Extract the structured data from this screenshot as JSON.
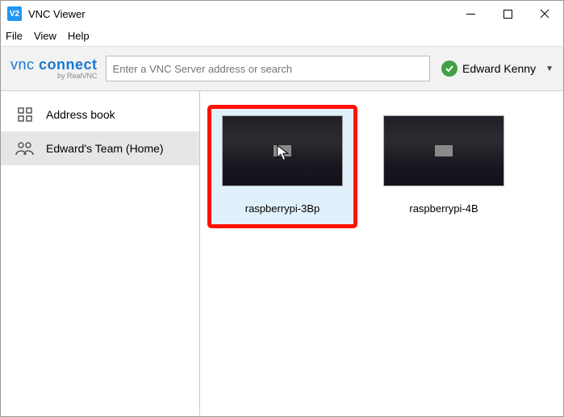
{
  "window": {
    "title": "VNC Viewer",
    "app_icon_text": "V2"
  },
  "menu": {
    "file": "File",
    "view": "View",
    "help": "Help"
  },
  "toolbar": {
    "logo_main_a": "vnc",
    "logo_main_b": "connect",
    "logo_sub": "by RealVNC",
    "search_placeholder": "Enter a VNC Server address or search",
    "user_name": "Edward Kenny"
  },
  "sidebar": {
    "items": [
      {
        "label": "Address book"
      },
      {
        "label": "Edward's Team (Home)"
      }
    ]
  },
  "connections": [
    {
      "label": "raspberrypi-3Bp",
      "selected": true
    },
    {
      "label": "raspberrypi-4B",
      "selected": false
    }
  ]
}
